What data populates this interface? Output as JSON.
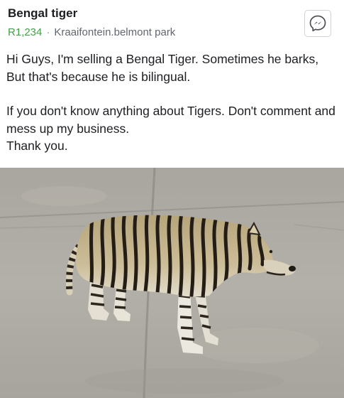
{
  "listing": {
    "title": "Bengal tiger",
    "price": "R1,234",
    "separator": "·",
    "location": "Kraaifontein.belmont park",
    "description": [
      "Hi Guys, I'm selling a Bengal Tiger. Sometimes he barks, But that's because he is bilingual.",
      "If you don't know anything about Tigers. Don't comment and mess up my business.\nThank you."
    ]
  },
  "icons": {
    "message": "messenger-icon"
  },
  "colors": {
    "price": "#42a046",
    "text": "#1c1e21",
    "meta": "#616770"
  }
}
